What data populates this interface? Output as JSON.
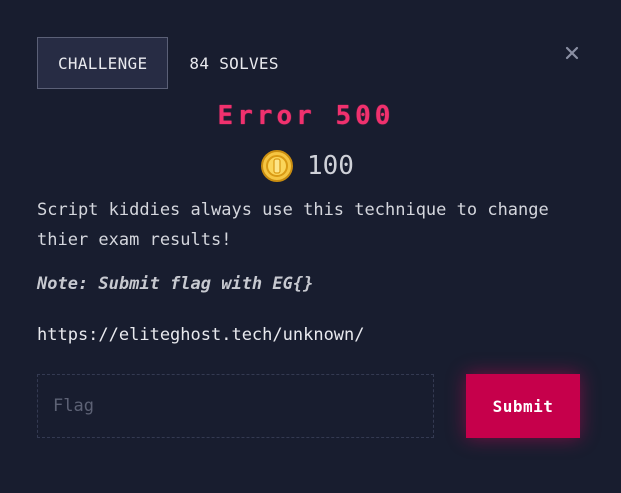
{
  "tabs": {
    "challenge_label": "CHALLENGE",
    "solves_label": "84 SOLVES"
  },
  "challenge": {
    "title": "Error 500",
    "points": "100",
    "description": "Script kiddies always use this technique to change thier exam results!",
    "note": "Note: Submit flag with EG{}",
    "link": "https://eliteghost.tech/unknown/"
  },
  "form": {
    "flag_placeholder": "Flag",
    "flag_value": "",
    "submit_label": "Submit"
  },
  "icons": {
    "close": "close-icon",
    "coin": "coin-icon"
  },
  "colors": {
    "background": "#181d2f",
    "title": "#f0316e",
    "submit": "#c6004b",
    "coin": "#f5c542"
  }
}
